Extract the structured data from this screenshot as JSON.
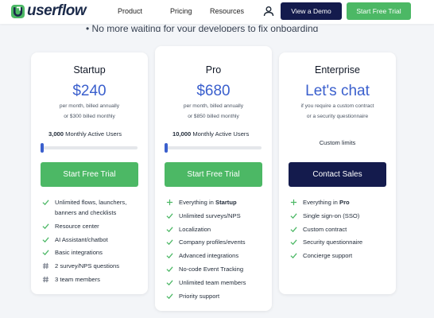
{
  "brand": {
    "name": "userflow",
    "accent": "#3a5fcd",
    "green": "#4cb865",
    "navy": "#141b4d"
  },
  "nav": {
    "links": [
      "Product",
      "Pricing",
      "Resources"
    ],
    "demo_label": "View a Demo",
    "trial_label": "Start Free Trial",
    "account_icon": "user-icon"
  },
  "subheading": "• No more waiting for your developers to fix onboarding",
  "plans": [
    {
      "name": "Startup",
      "price": "$240",
      "note_line1": "per month, billed annually",
      "note_line2": "or $300 billed monthly",
      "mau_count": "3,000",
      "mau_label": "Monthly Active Users",
      "slider_value": 0,
      "cta": "Start Free Trial",
      "features": [
        {
          "icon": "check-icon",
          "text": "Unlimited flows, launchers,"
        },
        {
          "icon": "",
          "text": "banners and checklists"
        },
        {
          "icon": "check-icon",
          "text": "Resource center"
        },
        {
          "icon": "check-icon",
          "text": "AI Assistant/chatbot"
        },
        {
          "icon": "check-icon",
          "text": "Basic integrations"
        },
        {
          "icon": "hash-icon",
          "text": "2 survey/NPS questions"
        },
        {
          "icon": "hash-icon",
          "text": "3 team members"
        }
      ]
    },
    {
      "name": "Pro",
      "price": "$680",
      "note_line1": "per month, billed annually",
      "note_line2": "or $850 billed monthly",
      "mau_count": "10,000",
      "mau_label": "Monthly Active Users",
      "slider_value": 0,
      "cta": "Start Free Trial",
      "features": [
        {
          "icon": "plus-icon",
          "prefix": "Everything in ",
          "bold": "Startup"
        },
        {
          "icon": "check-icon",
          "text": "Unlimited surveys/NPS"
        },
        {
          "icon": "check-icon",
          "text": "Localization"
        },
        {
          "icon": "check-icon",
          "text": "Company profiles/events"
        },
        {
          "icon": "check-icon",
          "text": "Advanced integrations"
        },
        {
          "icon": "check-icon",
          "text": "No-code Event Tracking"
        },
        {
          "icon": "check-icon",
          "text": "Unlimited team members"
        },
        {
          "icon": "check-icon",
          "text": "Priority support"
        }
      ]
    },
    {
      "name": "Enterprise",
      "price": "Let's chat",
      "note_line1": "if you require a custom contract",
      "note_line2": "or a security questionnaire",
      "custom_limits": "Custom limits",
      "cta": "Contact Sales",
      "features": [
        {
          "icon": "plus-icon",
          "prefix": "Everything in ",
          "bold": "Pro"
        },
        {
          "icon": "check-icon",
          "text": "Single sign-on (SSO)"
        },
        {
          "icon": "check-icon",
          "text": "Custom contract"
        },
        {
          "icon": "check-icon",
          "text": "Security questionnaire"
        },
        {
          "icon": "check-icon",
          "text": "Concierge support"
        }
      ]
    }
  ]
}
